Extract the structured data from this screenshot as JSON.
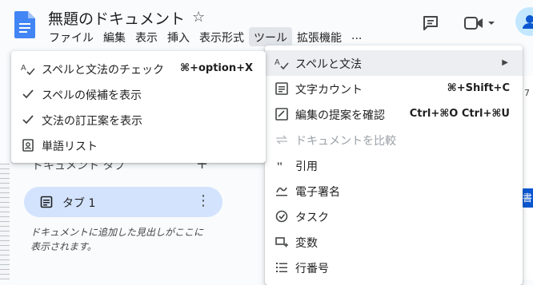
{
  "header": {
    "title": "無題のドキュメント",
    "menus": [
      "ファイル",
      "編集",
      "表示",
      "挿入",
      "表示形式",
      "ツール",
      "拡張機能",
      "..."
    ],
    "active_menu_index": 5
  },
  "sidebar": {
    "outline_heading": "ドキュメント タブ",
    "tab_label": "タブ 1",
    "hint": "ドキュメントに追加した見出しがここに表示されます。"
  },
  "document": {
    "ruler_number": "7",
    "side_chip": "書"
  },
  "tools_menu": {
    "items": [
      {
        "label": "スペルと文法",
        "shortcut": "",
        "icon": "spellcheck-icon",
        "submenu": true,
        "disabled": false
      },
      {
        "label": "文字カウント",
        "shortcut": "⌘+Shift+C",
        "icon": "word-count-icon",
        "submenu": false,
        "disabled": false
      },
      {
        "label": "編集の提案を確認",
        "shortcut": "Ctrl+⌘O Ctrl+⌘U",
        "icon": "review-edits-icon",
        "submenu": false,
        "disabled": false
      },
      {
        "label": "ドキュメントを比較",
        "shortcut": "",
        "icon": "compare-icon",
        "submenu": false,
        "disabled": true
      },
      {
        "label": "引用",
        "shortcut": "",
        "icon": "quote-icon",
        "submenu": false,
        "disabled": false
      },
      {
        "label": "電子署名",
        "shortcut": "",
        "icon": "signature-icon",
        "submenu": false,
        "disabled": false
      },
      {
        "label": "タスク",
        "shortcut": "",
        "icon": "task-icon",
        "submenu": false,
        "disabled": false
      },
      {
        "label": "変数",
        "shortcut": "",
        "icon": "variables-icon",
        "submenu": false,
        "disabled": false
      },
      {
        "label": "行番号",
        "shortcut": "",
        "icon": "line-numbers-icon",
        "submenu": false,
        "disabled": false
      }
    ]
  },
  "spelling_submenu": {
    "items": [
      {
        "label": "スペルと文法のチェック",
        "shortcut": "⌘+option+X",
        "icon": "spellcheck-icon"
      },
      {
        "label": "スペルの候補を表示",
        "shortcut": "",
        "icon": "check-icon"
      },
      {
        "label": "文法の訂正案を表示",
        "shortcut": "",
        "icon": "check-icon"
      },
      {
        "label": "単語リスト",
        "shortcut": "",
        "icon": "dictionary-icon"
      }
    ]
  }
}
